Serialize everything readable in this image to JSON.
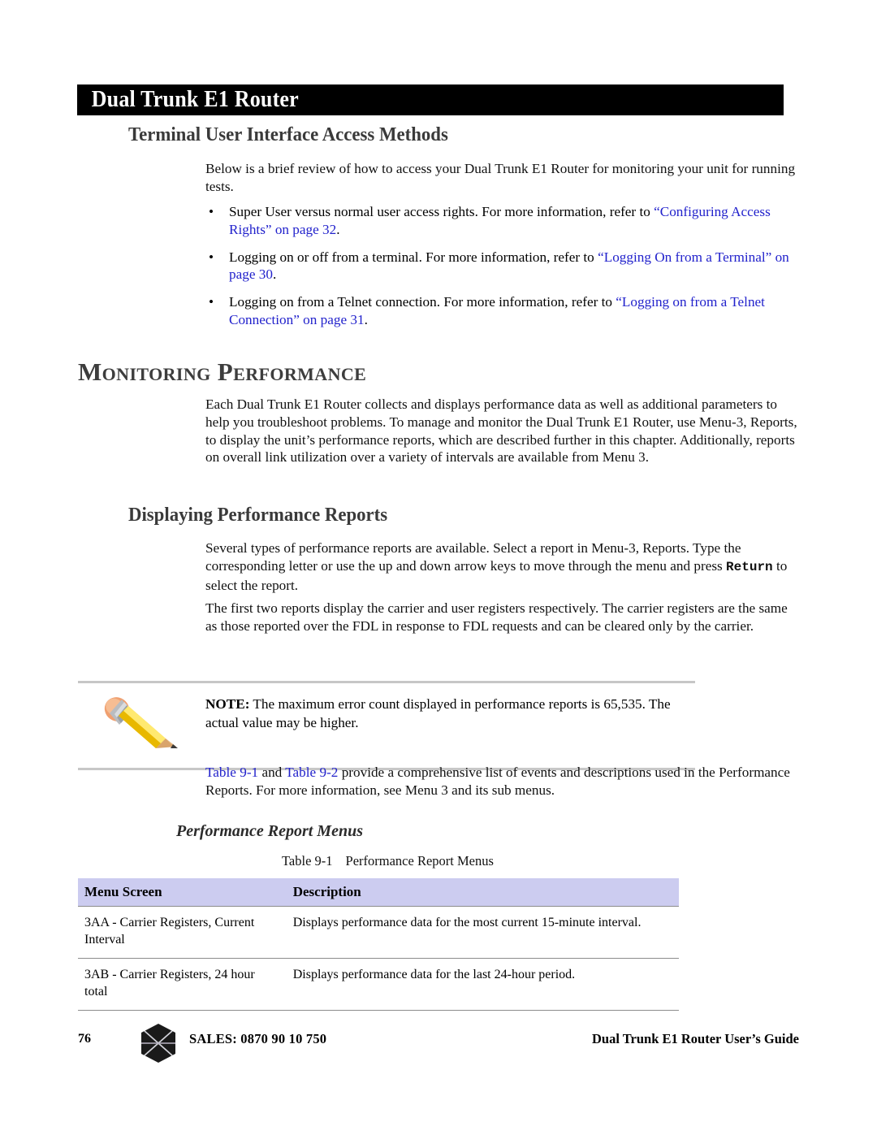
{
  "running_head": {
    "title": "Dual Trunk E1 Router"
  },
  "headings": {
    "terminal_access": "Terminal User Interface Access Methods",
    "monitoring_performance": "Monitoring Performance",
    "displaying_reports": "Displaying Performance Reports",
    "performance_report_menus": "Performance Report Menus"
  },
  "paragraphs": {
    "intro": "Below is a brief review of how to access your Dual Trunk E1 Router for monitoring your unit for running tests.",
    "monitoring": "Each Dual Trunk E1 Router collects and displays performance data as well as additional parameters to help you troubleshoot problems. To manage and monitor the Dual Trunk E1 Router, use Menu-3, Reports, to display the unit’s performance reports, which are described further in this chapter. Additionally, reports on overall link utilization over a variety of intervals are available from Menu 3.",
    "several_pre": "Several types of performance reports are available. Select a report in Menu-3, Reports. Type the corresponding letter or use the up and down arrow keys to move through the menu and press ",
    "several_key": "Return",
    "several_post": " to select the report.",
    "first_two": "The first two reports display the carrier and user registers respectively. The carrier registers are the same as those reported over the FDL in response to FDL requests and can be cleared only by the carrier.",
    "tables_pre": "",
    "tables_link1": "Table 9-1",
    "tables_mid": " and ",
    "tables_link2": "Table 9-2",
    "tables_post": " provide a comprehensive list of events and descriptions used in the Performance Reports. For more information, see Menu 3 and its sub menus."
  },
  "bullets": [
    {
      "bullet_char": "•",
      "text_before": "Super User versus normal user access rights. For more information, refer to ",
      "link": "“Configuring Access Rights” on page 32",
      "text_after": "."
    },
    {
      "bullet_char": "•",
      "text_before": "Logging on or off from a terminal. For more information, refer to ",
      "link": "“Logging On from a Terminal” on page 30",
      "text_after": "."
    },
    {
      "bullet_char": "•",
      "text_before": "Logging on from a Telnet connection. For more information, refer to ",
      "link": "“Logging on from a Telnet Connection” on page 31",
      "text_after": "."
    }
  ],
  "note": {
    "icon": "pencil-icon",
    "label": "NOTE:",
    "text": " The maximum error count displayed in performance reports is 65,535. The actual value may be higher."
  },
  "table": {
    "caption_number": "Table 9-1",
    "caption_title": "Performance Report Menus",
    "header_bg": "#ccccf0",
    "columns": [
      "Menu Screen",
      "Description"
    ],
    "rows": [
      {
        "menu_screen": "3AA - Carrier Registers, Current Interval",
        "description": "Displays performance data for the most current 15-minute interval."
      },
      {
        "menu_screen": "3AB - Carrier Registers, 24 hour total",
        "description": "Displays performance data for the last 24-hour period."
      }
    ]
  },
  "footer": {
    "page_number": "76",
    "logo": "hexagon-diamond-logo",
    "sales": "SALES:  0870 90 10 750",
    "guide_title": "Dual Trunk E1 Router User’s Guide"
  },
  "colors": {
    "link": "#2222cc",
    "running_head_bg": "#000000",
    "heading_gray": "#3a3a3a",
    "rule_gray": "#c7c7c7",
    "table_border": "#8c8c8c"
  }
}
